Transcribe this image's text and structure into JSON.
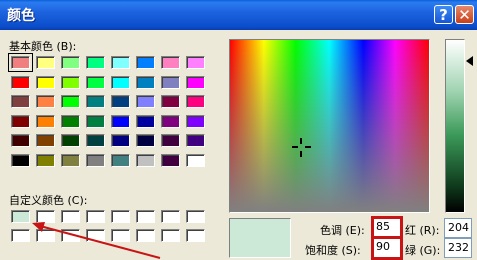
{
  "window": {
    "title": "颜色",
    "help": "?",
    "close": "✕"
  },
  "labels": {
    "basic": "基本颜色 (B):",
    "custom": "自定义颜色 (C):"
  },
  "basic_colors": [
    "#f08080",
    "#ffff80",
    "#80ff80",
    "#00ff80",
    "#80ffff",
    "#0080ff",
    "#ff80c0",
    "#ff80ff",
    "#ff0000",
    "#ffff00",
    "#80ff00",
    "#00ff40",
    "#00ffff",
    "#0080c0",
    "#8080c0",
    "#ff00ff",
    "#804040",
    "#ff8040",
    "#00ff00",
    "#008080",
    "#004080",
    "#8080ff",
    "#800040",
    "#ff0080",
    "#800000",
    "#ff8000",
    "#008000",
    "#008040",
    "#0000ff",
    "#0000a0",
    "#800080",
    "#8000ff",
    "#400000",
    "#804000",
    "#004000",
    "#004040",
    "#000080",
    "#000040",
    "#400040",
    "#400080",
    "#000000",
    "#808000",
    "#808040",
    "#808080",
    "#408080",
    "#c0c0c0",
    "#400040",
    "#ffffff"
  ],
  "custom_colors": [
    "#cce8d6",
    "#ffffff",
    "#ffffff",
    "#ffffff",
    "#ffffff",
    "#ffffff",
    "#ffffff",
    "#ffffff",
    "#ffffff",
    "#ffffff",
    "#ffffff",
    "#ffffff",
    "#ffffff",
    "#ffffff",
    "#ffffff",
    "#ffffff"
  ],
  "fields": {
    "hue": {
      "label": "色调 (E):",
      "value": "85"
    },
    "sat": {
      "label": "饱和度 (S):",
      "value": "90"
    },
    "red": {
      "label": "红 (R):",
      "value": "204"
    },
    "green": {
      "label": "绿 (G):",
      "value": "232"
    }
  }
}
